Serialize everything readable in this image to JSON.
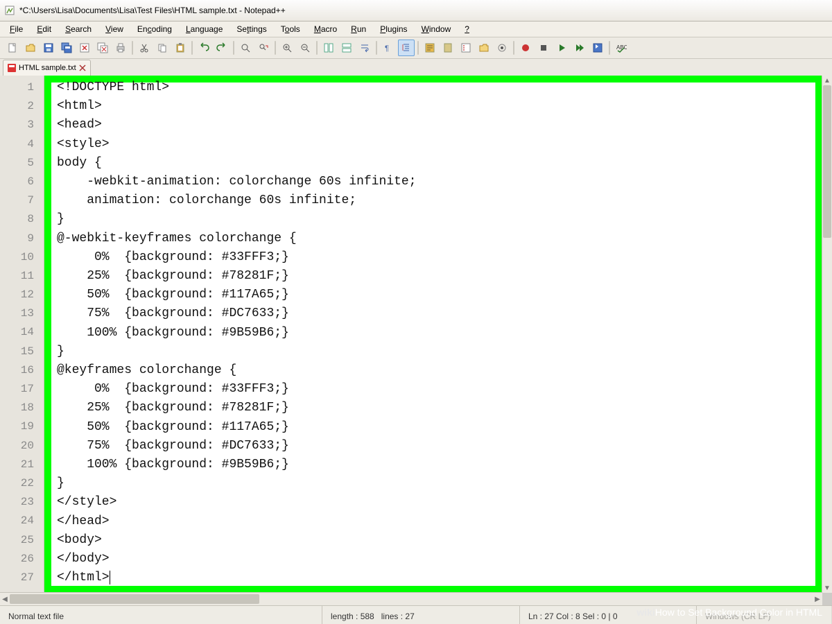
{
  "title": "*C:\\Users\\Lisa\\Documents\\Lisa\\Test Files\\HTML sample.txt - Notepad++",
  "menu": [
    "File",
    "Edit",
    "Search",
    "View",
    "Encoding",
    "Language",
    "Settings",
    "Tools",
    "Macro",
    "Run",
    "Plugins",
    "Window",
    "?"
  ],
  "tab": {
    "label": "HTML sample.txt",
    "modified": true
  },
  "code_lines": [
    "<!DOCTYPE html>",
    "<html>",
    "<head>",
    "<style>",
    "body {",
    "    -webkit-animation: colorchange 60s infinite;",
    "    animation: colorchange 60s infinite;",
    "}",
    "@-webkit-keyframes colorchange {",
    "     0%  {background: #33FFF3;}",
    "    25%  {background: #78281F;}",
    "    50%  {background: #117A65;}",
    "    75%  {background: #DC7633;}",
    "    100% {background: #9B59B6;}",
    "}",
    "@keyframes colorchange {",
    "     0%  {background: #33FFF3;}",
    "    25%  {background: #78281F;}",
    "    50%  {background: #117A65;}",
    "    75%  {background: #DC7633;}",
    "    100% {background: #9B59B6;}",
    "}",
    "</style>",
    "</head>",
    "<body>",
    "</body>",
    "</html>"
  ],
  "status": {
    "type": "Normal text file",
    "length_label": "length : 588",
    "lines_label": "lines : 27",
    "pos": "Ln : 27   Col : 8   Sel : 0 | 0",
    "eol": "Windows (CR LF)"
  },
  "watermark": {
    "brand": "wiki",
    "how": "How to Set Background Color in HTML"
  }
}
